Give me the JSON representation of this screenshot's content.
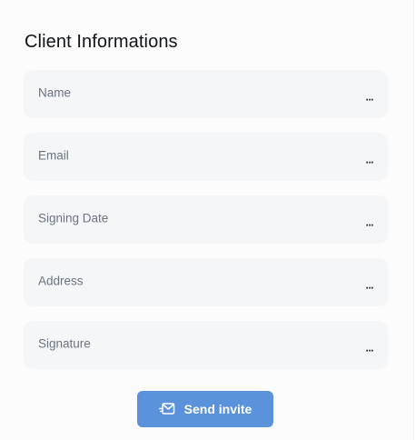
{
  "section": {
    "title": "Client Informations"
  },
  "fields": [
    {
      "label": "Name",
      "more": "..."
    },
    {
      "label": "Email",
      "more": "..."
    },
    {
      "label": "Signing Date",
      "more": "..."
    },
    {
      "label": "Address",
      "more": "..."
    },
    {
      "label": "Signature",
      "more": "..."
    }
  ],
  "actions": {
    "send_invite_label": "Send invite",
    "send_invite_icon": "send-mail-icon"
  },
  "colors": {
    "accent": "#5a93dc",
    "field_background": "#f5f6f8",
    "label_text": "#6b7380",
    "title_text": "#111418"
  }
}
